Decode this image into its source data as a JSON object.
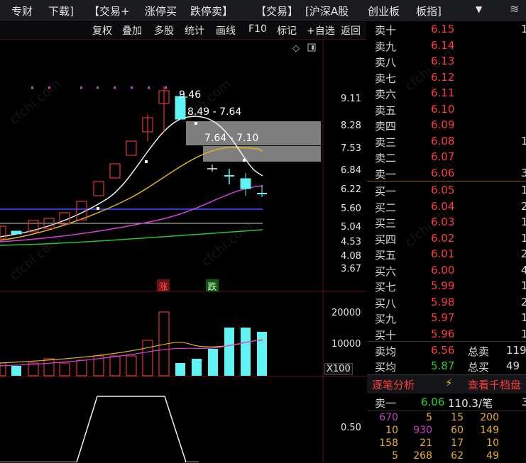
{
  "top_menu": [
    "专财",
    "下载]",
    "【交易+",
    "涨停买",
    "跌停卖】",
    "【交易】",
    "[沪深A股",
    "创业板",
    "板指]"
  ],
  "toolbar": [
    "复权",
    "叠加",
    "多股",
    "统计",
    "画线",
    "F10",
    "标记",
    "+自选",
    "返回"
  ],
  "chart": {
    "annotations": {
      "high": "9.46",
      "range1": "8.49 - 7.64",
      "range2": "7.64 - 7.10"
    },
    "price_axis": [
      "9.11",
      "8.28",
      "7.53",
      "6.84",
      "6.22",
      "5.60",
      "5.04",
      "4.53",
      "4.08",
      "3.67"
    ],
    "badges": {
      "limit_up": "涨",
      "limit_down": "跌"
    },
    "volume_axis": [
      "20000",
      "10000"
    ],
    "volume_unit": "X100",
    "indicator_axis": [
      "0.50"
    ],
    "watermark": "cfchi.com"
  },
  "order_book": {
    "asks": [
      {
        "name": "卖十",
        "price": "6.15",
        "vol": "1"
      },
      {
        "name": "卖九",
        "price": "6.14",
        "vol": ""
      },
      {
        "name": "卖八",
        "price": "6.13",
        "vol": ""
      },
      {
        "name": "卖七",
        "price": "6.12",
        "vol": ""
      },
      {
        "name": "卖六",
        "price": "6.11",
        "vol": ""
      },
      {
        "name": "卖五",
        "price": "6.10",
        "vol": ""
      },
      {
        "name": "卖四",
        "price": "6.09",
        "vol": ""
      },
      {
        "name": "卖三",
        "price": "6.08",
        "vol": "1"
      },
      {
        "name": "卖二",
        "price": "6.07",
        "vol": ""
      },
      {
        "name": "卖一",
        "price": "6.06",
        "vol": "3"
      }
    ],
    "bids": [
      {
        "name": "买一",
        "price": "6.05",
        "vol": "1"
      },
      {
        "name": "买二",
        "price": "6.04",
        "vol": "2"
      },
      {
        "name": "买三",
        "price": "6.03",
        "vol": "1"
      },
      {
        "name": "买四",
        "price": "6.02",
        "vol": "1"
      },
      {
        "name": "买五",
        "price": "6.01",
        "vol": "2"
      },
      {
        "name": "买六",
        "price": "6.00",
        "vol": "4"
      },
      {
        "name": "买七",
        "price": "5.99",
        "vol": "1"
      },
      {
        "name": "买八",
        "price": "5.98",
        "vol": "2"
      },
      {
        "name": "买九",
        "price": "5.97",
        "vol": "1"
      },
      {
        "name": "买十",
        "price": "5.96",
        "vol": "1"
      }
    ],
    "summary": {
      "ask_avg_label": "卖均",
      "ask_avg": "6.56",
      "total_ask_label": "总卖",
      "total_ask": "119",
      "bid_avg_label": "买均",
      "bid_avg": "5.87",
      "total_bid_label": "总买",
      "total_bid": "49"
    },
    "tabs": {
      "tick_analysis": "逐笔分析",
      "view_thousand": "查看千档盘"
    },
    "last_trade": {
      "label": "卖一",
      "price": "6.06",
      "detail": "110.3/笔",
      "extra": "3"
    },
    "ticks": [
      [
        "670",
        "5",
        "15",
        "200"
      ],
      [
        "10",
        "930",
        "60",
        "149"
      ],
      [
        "158",
        "21",
        "17",
        "10"
      ],
      [
        "5",
        "268",
        "62",
        "49"
      ]
    ]
  }
}
